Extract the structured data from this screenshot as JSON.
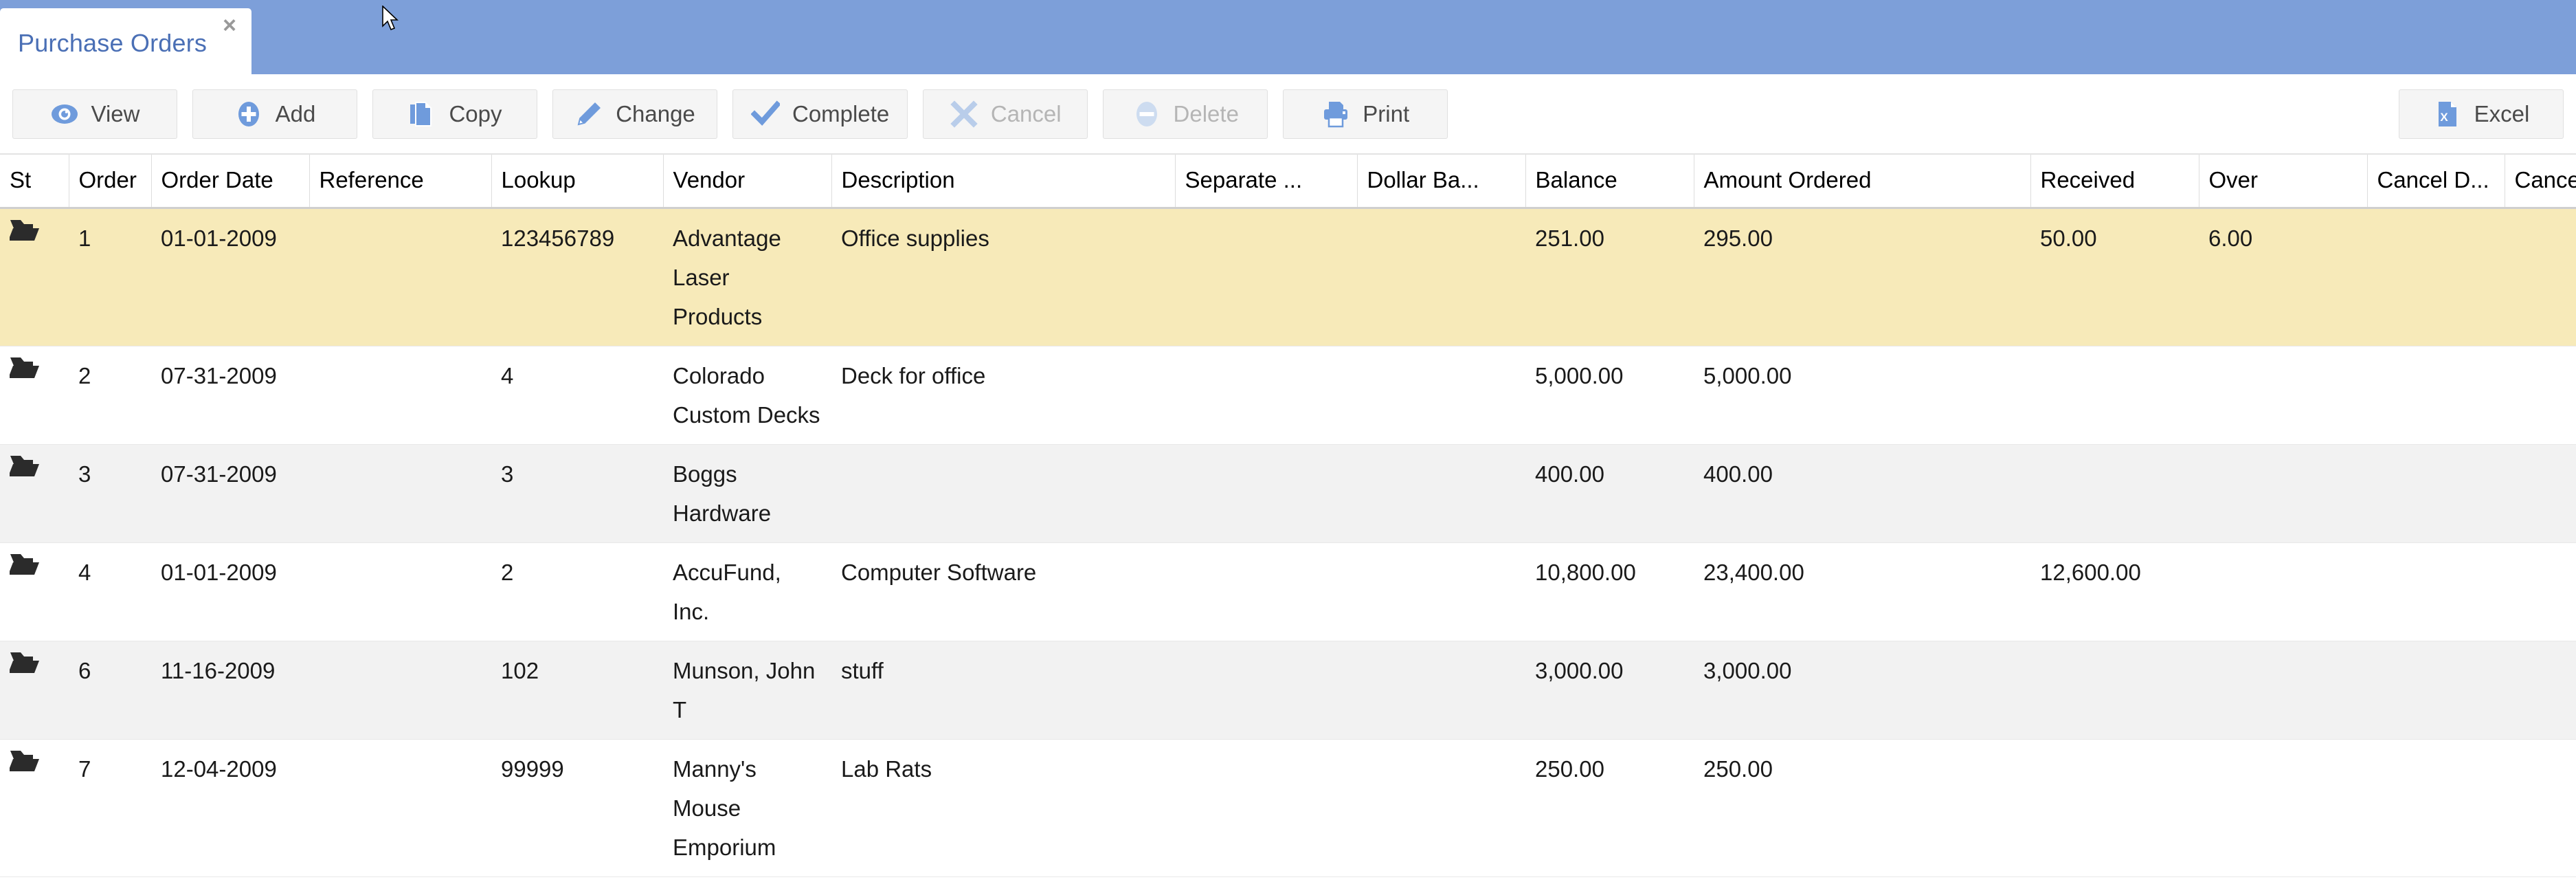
{
  "window": {
    "tab_title": "Purchase Orders",
    "close_glyph": "×",
    "header_color": "#7d9fd9",
    "tab_text_color": "#4a6fb5"
  },
  "toolbar": {
    "buttons": [
      {
        "label": "View",
        "icon": "eye-icon",
        "enabled": true
      },
      {
        "label": "Add",
        "icon": "plus-circle-icon",
        "enabled": true
      },
      {
        "label": "Copy",
        "icon": "copy-icon",
        "enabled": true
      },
      {
        "label": "Change",
        "icon": "pencil-icon",
        "enabled": true
      },
      {
        "label": "Complete",
        "icon": "check-icon",
        "enabled": true
      },
      {
        "label": "Cancel",
        "icon": "x-icon",
        "enabled": false
      },
      {
        "label": "Delete",
        "icon": "minus-circle-icon",
        "enabled": false
      },
      {
        "label": "Print",
        "icon": "printer-icon",
        "enabled": true
      }
    ],
    "export": {
      "label": "Excel",
      "icon": "excel-file-icon",
      "enabled": true
    },
    "accent_color": "#6f9bdc",
    "disabled_color": "#b5b5b5"
  },
  "table": {
    "columns": [
      "St",
      "Order",
      "Order Date",
      "Reference",
      "Lookup",
      "Vendor",
      "Description",
      "Separate ...",
      "Dollar Ba...",
      "Balance",
      "Amount Ordered",
      "Received",
      "Over",
      "Cancel D...",
      "Cancelled"
    ],
    "row_icon": "open-folder-icon",
    "number_color": "#3f7f28",
    "selected_row_color": "#f7eab9",
    "rows": [
      {
        "selected": true,
        "order": "1",
        "order_date": "01-01-2009",
        "reference": "",
        "lookup": "123456789",
        "vendor": "Advantage Laser Products",
        "description": "Office supplies",
        "separate": "",
        "dollar_balance": "",
        "balance": "251.00",
        "amount_ordered": "295.00",
        "received": "50.00",
        "over": "6.00",
        "cancel_date": "",
        "cancelled": ""
      },
      {
        "selected": false,
        "order": "2",
        "order_date": "07-31-2009",
        "reference": "",
        "lookup": "4",
        "vendor": "Colorado Custom Decks",
        "description": "Deck for office",
        "separate": "",
        "dollar_balance": "",
        "balance": "5,000.00",
        "amount_ordered": "5,000.00",
        "received": "",
        "over": "",
        "cancel_date": "",
        "cancelled": ""
      },
      {
        "selected": false,
        "order": "3",
        "order_date": "07-31-2009",
        "reference": "",
        "lookup": "3",
        "vendor": "Boggs Hardware",
        "description": "",
        "separate": "",
        "dollar_balance": "",
        "balance": "400.00",
        "amount_ordered": "400.00",
        "received": "",
        "over": "",
        "cancel_date": "",
        "cancelled": ""
      },
      {
        "selected": false,
        "order": "4",
        "order_date": "01-01-2009",
        "reference": "",
        "lookup": "2",
        "vendor": "AccuFund, Inc.",
        "description": "Computer Software",
        "separate": "",
        "dollar_balance": "",
        "balance": "10,800.00",
        "amount_ordered": "23,400.00",
        "received": "12,600.00",
        "over": "",
        "cancel_date": "",
        "cancelled": ""
      },
      {
        "selected": false,
        "order": "6",
        "order_date": "11-16-2009",
        "reference": "",
        "lookup": "102",
        "vendor": "Munson, John T",
        "description": "stuff",
        "separate": "",
        "dollar_balance": "",
        "balance": "3,000.00",
        "amount_ordered": "3,000.00",
        "received": "",
        "over": "",
        "cancel_date": "",
        "cancelled": ""
      },
      {
        "selected": false,
        "order": "7",
        "order_date": "12-04-2009",
        "reference": "",
        "lookup": "99999",
        "vendor": "Manny's Mouse Emporium",
        "description": "Lab Rats",
        "separate": "",
        "dollar_balance": "",
        "balance": "250.00",
        "amount_ordered": "250.00",
        "received": "",
        "over": "",
        "cancel_date": "",
        "cancelled": ""
      }
    ]
  }
}
